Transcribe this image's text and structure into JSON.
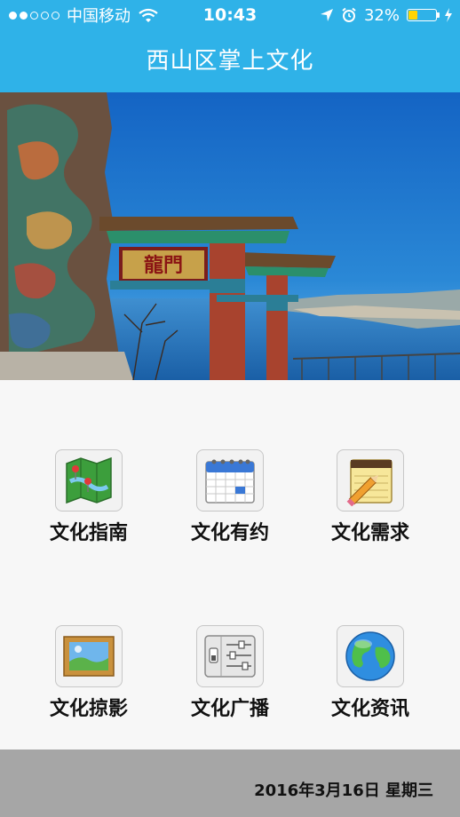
{
  "status_bar": {
    "carrier": "中国移动",
    "time": "10:43",
    "battery_percent": "32%",
    "battery_level": 0.32,
    "signal_bars": 2,
    "icons": [
      "signal-icon",
      "wifi-icon",
      "location-icon",
      "alarm-icon",
      "battery-icon",
      "charging-icon"
    ]
  },
  "header": {
    "title": "西山区掌上文化"
  },
  "banner": {
    "plaque_text": "龍門",
    "slides": 3,
    "active_slide": 1
  },
  "menu": {
    "items": [
      {
        "label": "文化指南",
        "icon": "map-icon"
      },
      {
        "label": "文化有约",
        "icon": "calendar-icon"
      },
      {
        "label": "文化需求",
        "icon": "notepad-icon"
      },
      {
        "label": "文化掠影",
        "icon": "picture-icon"
      },
      {
        "label": "文化广播",
        "icon": "settings-sliders-icon"
      },
      {
        "label": "文化资讯",
        "icon": "globe-icon"
      }
    ]
  },
  "footer": {
    "date": "2016年3月16日 星期三"
  },
  "colors": {
    "header_bg": "#2fb2e8",
    "footer_bg": "#a6a6a6",
    "page_bg": "#f7f7f7"
  }
}
